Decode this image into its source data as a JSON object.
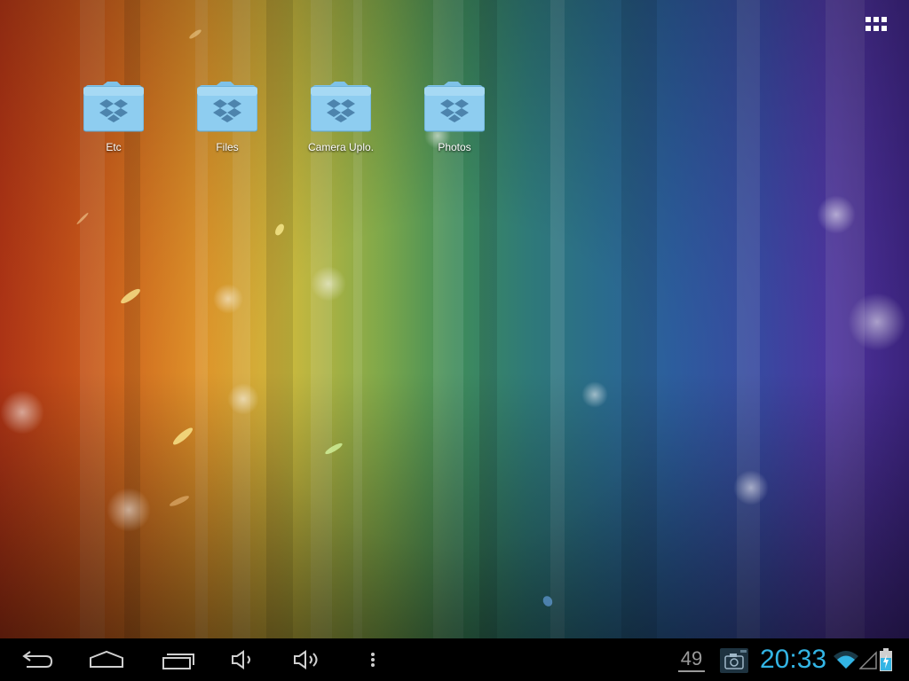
{
  "desktop": {
    "folders": [
      {
        "label": "Etc"
      },
      {
        "label": "Files"
      },
      {
        "label": "Camera Uplo."
      },
      {
        "label": "Photos"
      }
    ]
  },
  "status_bar": {
    "notification_count": "49",
    "time": "20:33"
  },
  "icons": {
    "apps": "apps-grid-icon",
    "folder": "dropbox-folder-icon",
    "back": "back-arrow-icon",
    "home": "home-icon",
    "recents": "recent-apps-icon",
    "volume_down": "volume-down-icon",
    "volume_up": "volume-up-icon",
    "menu": "overflow-menu-icon",
    "screenshot": "camera-icon",
    "wifi": "wifi-icon",
    "signal": "signal-icon",
    "battery": "battery-charging-icon"
  },
  "colors": {
    "clock": "#33b5e5",
    "folder": "#8ecdf0",
    "nav_icon": "#cfcfcf"
  }
}
